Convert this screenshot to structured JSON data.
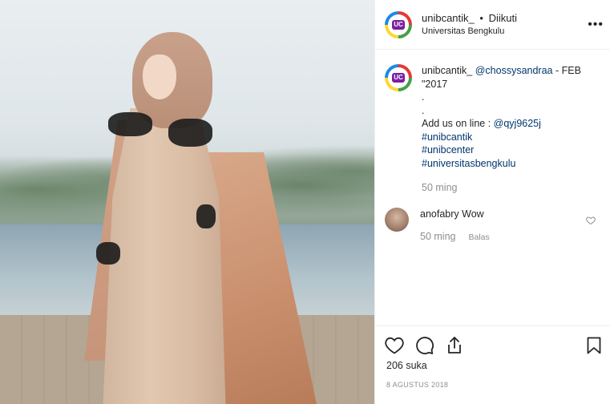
{
  "post": {
    "photo_alt": "photo",
    "header": {
      "username": "unibcantik_",
      "separator": "•",
      "follow_status": "Diikuti",
      "location": "Universitas Bengkulu",
      "logo_text": "UC",
      "more": "•••"
    },
    "caption": {
      "username": "unibcantik_",
      "mention": "@chossysandraa",
      "text_after_mention": " - FEB",
      "line2": "\"2017",
      "line3": ".",
      "line4": ".",
      "line5_prefix": "Add us on line : ",
      "line5_link": "@qyj9625j",
      "hashtags": [
        "#unibcantik",
        "#unibcenter",
        "#universitasbengkulu"
      ],
      "time": "50 ming"
    },
    "comment": {
      "username": "anofabry",
      "text": "Wow",
      "time": "50 ming",
      "reply_label": "Balas"
    },
    "likes": "206 suka",
    "date": "8 AGUSTUS 2018"
  },
  "colors": {
    "link": "#00376b",
    "muted": "#8e8e8e",
    "text": "#262626",
    "border": "#efefef"
  }
}
